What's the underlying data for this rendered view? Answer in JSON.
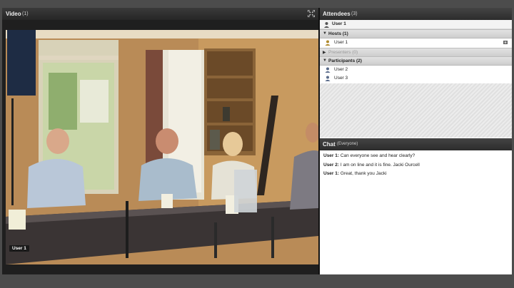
{
  "video": {
    "title": "Video",
    "count": "(1)",
    "camera_label": "User 1"
  },
  "attendees": {
    "title": "Attendees",
    "count": "(3)",
    "me_label": "User 1",
    "groups": [
      {
        "label": "Hosts (1)",
        "expanded": true,
        "users": [
          "User 1"
        ]
      },
      {
        "label": "Presenters (0)",
        "expanded": false,
        "users": []
      },
      {
        "label": "Participants (2)",
        "expanded": true,
        "users": [
          "User 2",
          "User 3"
        ]
      }
    ]
  },
  "chat": {
    "title": "Chat",
    "scope": "(Everyone)",
    "messages": [
      {
        "sender": "User 1:",
        "text": " Can everyone see and hear clearly?"
      },
      {
        "sender": "User 2:",
        "text": " I am on line and it is fine.  Jacki Ourcell"
      },
      {
        "sender": "User 1:",
        "text": " Great, thank you Jacki"
      }
    ]
  },
  "colors": {
    "header_bg": "#2c2c2c",
    "header_text": "#eeeeee",
    "group_bg": "#d6d6d6",
    "background": "#4c4c4c"
  }
}
